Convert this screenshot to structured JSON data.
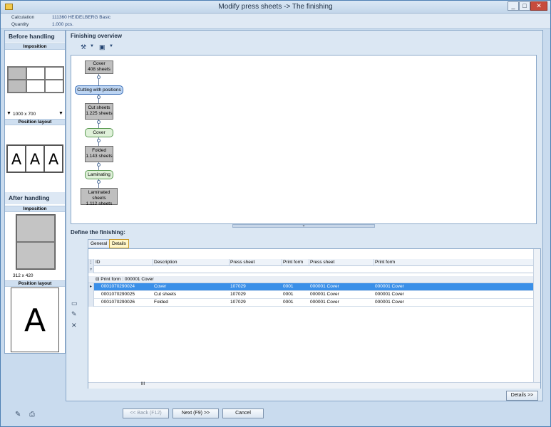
{
  "window": {
    "title": "Modify press sheets -> The finishing",
    "min": "_",
    "max": "□",
    "close": "✕"
  },
  "info": {
    "calculation_label": "Calculation",
    "calculation_value": "111360 HEIDELBERG Basic",
    "quantity_label": "Quantity",
    "quantity_value": "1.000 pcs."
  },
  "left": {
    "before_title": "Before handling",
    "before_imposition": "Imposition",
    "before_size": "1000 x 700",
    "before_position_layout": "Position layout",
    "letters": [
      "A",
      "A",
      "A"
    ],
    "after_title": "After handling",
    "after_imposition": "Imposition",
    "after_size": "312 x 420",
    "after_position_layout": "Position layout",
    "after_letter": "A"
  },
  "overview": {
    "title": "Finishing overview",
    "nodes": [
      {
        "line1": "Cover",
        "line2": "408 sheets",
        "kind": "grey"
      },
      {
        "line1": "Cutting with positions",
        "line2": "",
        "kind": "blue"
      },
      {
        "line1": "Cut sheets",
        "line2": "1.225 sheets",
        "kind": "grey"
      },
      {
        "line1": "Cover",
        "line2": "",
        "kind": "green"
      },
      {
        "line1": "Folded",
        "line2": "1.143 sheets",
        "kind": "grey"
      },
      {
        "line1": "Laminating",
        "line2": "",
        "kind": "green"
      },
      {
        "line1": "Laminated sheets",
        "line2": "1.112 sheets",
        "kind": "grey"
      }
    ]
  },
  "define": {
    "title": "Define the finishing:",
    "tabs": [
      "General",
      "Details"
    ],
    "columns": [
      "ID",
      "Description",
      "Press sheet",
      "Print form",
      "Press sheet",
      "Print form"
    ],
    "group": "Print form : 000001 Cover",
    "rows": [
      [
        "0001070290024",
        "Cover",
        "107029",
        "0001",
        "000001 Cover",
        "000001 Cover"
      ],
      [
        "0001070290025",
        "Cut sheets",
        "107029",
        "0001",
        "000001 Cover",
        "000001 Cover"
      ],
      [
        "0001070290026",
        "Folded",
        "107029",
        "0001",
        "000001 Cover",
        "000001 Cover"
      ]
    ],
    "details_button": "Details >>"
  },
  "footer": {
    "back": "<< Back (F12)",
    "next": "Next (F9) >>",
    "cancel": "Cancel"
  }
}
